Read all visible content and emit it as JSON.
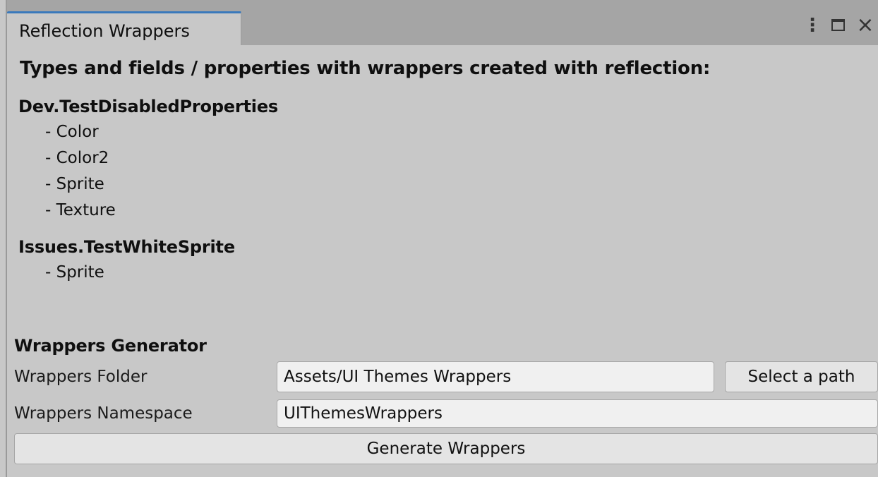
{
  "window": {
    "tab_label": "Reflection Wrappers",
    "controls": {
      "menu_icon": "⋮",
      "maximize_icon": "maximize-icon",
      "close_icon": "×"
    }
  },
  "reflection": {
    "title": "Types and fields / properties with wrappers created with reflection:",
    "types": [
      {
        "name": "Dev.TestDisabledProperties",
        "fields": [
          "- Color",
          "- Color2",
          "- Sprite",
          "- Texture"
        ]
      },
      {
        "name": "Issues.TestWhiteSprite",
        "fields": [
          "- Sprite"
        ]
      }
    ]
  },
  "generator": {
    "header": "Wrappers Generator",
    "folder_label": "Wrappers Folder",
    "folder_value": "Assets/UI Themes Wrappers",
    "select_path_label": "Select a path",
    "namespace_label": "Wrappers Namespace",
    "namespace_value": "UIThemesWrappers",
    "generate_label": "Generate Wrappers"
  },
  "colors": {
    "background": "#c8c8c8",
    "tabbar": "#a5a5a5",
    "tab_accent": "#3a79bb",
    "input_bg": "#f0f0f0",
    "button_bg": "#e4e4e4"
  }
}
